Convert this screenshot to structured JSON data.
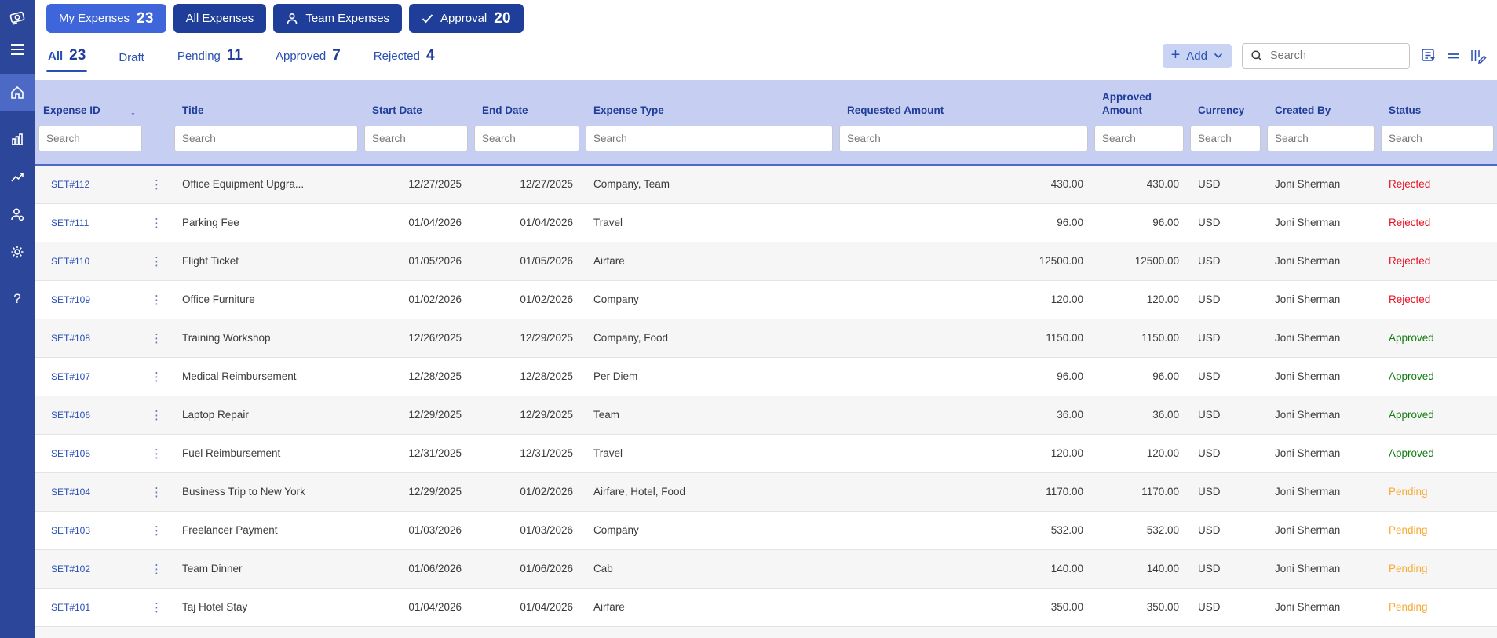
{
  "sidebar": {
    "items": [
      {
        "name": "app-logo"
      },
      {
        "name": "menu"
      },
      {
        "name": "home",
        "active": true
      },
      {
        "name": "analytics"
      },
      {
        "name": "reports"
      },
      {
        "name": "user-management"
      },
      {
        "name": "settings"
      },
      {
        "name": "help",
        "glyph": "?"
      }
    ]
  },
  "top_tabs": [
    {
      "label": "My Expenses",
      "count": "23",
      "active": true
    },
    {
      "label": "All Expenses"
    },
    {
      "label": "Team Expenses",
      "icon": "person"
    },
    {
      "label": "Approval",
      "count": "20",
      "icon": "check"
    }
  ],
  "filter_tabs": [
    {
      "label": "All",
      "count": "23",
      "active": true
    },
    {
      "label": "Draft"
    },
    {
      "label": "Pending",
      "count": "11"
    },
    {
      "label": "Approved",
      "count": "7"
    },
    {
      "label": "Rejected",
      "count": "4"
    }
  ],
  "toolbar": {
    "add_label": "Add",
    "search_placeholder": "Search",
    "icons": [
      "filter-list-icon",
      "row-lines-icon",
      "edit-columns-icon"
    ]
  },
  "grid": {
    "columns": [
      {
        "label": "Expense ID",
        "sorted": "desc"
      },
      {
        "label": ""
      },
      {
        "label": "Title"
      },
      {
        "label": "Start Date"
      },
      {
        "label": "End Date"
      },
      {
        "label": "Expense Type"
      },
      {
        "label": "Requested Amount"
      },
      {
        "label": "Approved Amount"
      },
      {
        "label": "Currency"
      },
      {
        "label": "Created By"
      },
      {
        "label": "Status"
      }
    ],
    "sort_indicator": "↓",
    "row_menu_glyph": "⋮",
    "filter_placeholder": "Search",
    "status_colors": {
      "Rejected": "#e81123",
      "Approved": "#107c10",
      "Pending": "#f8a932"
    },
    "rows": [
      {
        "id": "SET#112",
        "title": "Office Equipment Upgra...",
        "start": "12/27/2025",
        "end": "12/27/2025",
        "type": "Company, Team",
        "requested": "430.00",
        "approved": "430.00",
        "currency": "USD",
        "created_by": "Joni Sherman",
        "status": "Rejected"
      },
      {
        "id": "SET#111",
        "title": "Parking Fee",
        "start": "01/04/2026",
        "end": "01/04/2026",
        "type": "Travel",
        "requested": "96.00",
        "approved": "96.00",
        "currency": "USD",
        "created_by": "Joni Sherman",
        "status": "Rejected"
      },
      {
        "id": "SET#110",
        "title": "Flight Ticket",
        "start": "01/05/2026",
        "end": "01/05/2026",
        "type": "Airfare",
        "requested": "12500.00",
        "approved": "12500.00",
        "currency": "USD",
        "created_by": "Joni Sherman",
        "status": "Rejected"
      },
      {
        "id": "SET#109",
        "title": "Office Furniture",
        "start": "01/02/2026",
        "end": "01/02/2026",
        "type": "Company",
        "requested": "120.00",
        "approved": "120.00",
        "currency": "USD",
        "created_by": "Joni Sherman",
        "status": "Rejected"
      },
      {
        "id": "SET#108",
        "title": "Training Workshop",
        "start": "12/26/2025",
        "end": "12/29/2025",
        "type": "Company, Food",
        "requested": "1150.00",
        "approved": "1150.00",
        "currency": "USD",
        "created_by": "Joni Sherman",
        "status": "Approved"
      },
      {
        "id": "SET#107",
        "title": "Medical Reimbursement",
        "start": "12/28/2025",
        "end": "12/28/2025",
        "type": "Per Diem",
        "requested": "96.00",
        "approved": "96.00",
        "currency": "USD",
        "created_by": "Joni Sherman",
        "status": "Approved"
      },
      {
        "id": "SET#106",
        "title": "Laptop Repair",
        "start": "12/29/2025",
        "end": "12/29/2025",
        "type": "Team",
        "requested": "36.00",
        "approved": "36.00",
        "currency": "USD",
        "created_by": "Joni Sherman",
        "status": "Approved"
      },
      {
        "id": "SET#105",
        "title": "Fuel Reimbursement",
        "start": "12/31/2025",
        "end": "12/31/2025",
        "type": "Travel",
        "requested": "120.00",
        "approved": "120.00",
        "currency": "USD",
        "created_by": "Joni Sherman",
        "status": "Approved"
      },
      {
        "id": "SET#104",
        "title": "Business Trip to New York",
        "start": "12/29/2025",
        "end": "01/02/2026",
        "type": "Airfare, Hotel, Food",
        "requested": "1170.00",
        "approved": "1170.00",
        "currency": "USD",
        "created_by": "Joni Sherman",
        "status": "Pending"
      },
      {
        "id": "SET#103",
        "title": "Freelancer Payment",
        "start": "01/03/2026",
        "end": "01/03/2026",
        "type": "Company",
        "requested": "532.00",
        "approved": "532.00",
        "currency": "USD",
        "created_by": "Joni Sherman",
        "status": "Pending"
      },
      {
        "id": "SET#102",
        "title": "Team Dinner",
        "start": "01/06/2026",
        "end": "01/06/2026",
        "type": "Cab",
        "requested": "140.00",
        "approved": "140.00",
        "currency": "USD",
        "created_by": "Joni Sherman",
        "status": "Pending"
      },
      {
        "id": "SET#101",
        "title": "Taj Hotel Stay",
        "start": "01/04/2026",
        "end": "01/04/2026",
        "type": "Airfare",
        "requested": "350.00",
        "approved": "350.00",
        "currency": "USD",
        "created_by": "Joni Sherman",
        "status": "Pending"
      }
    ]
  }
}
